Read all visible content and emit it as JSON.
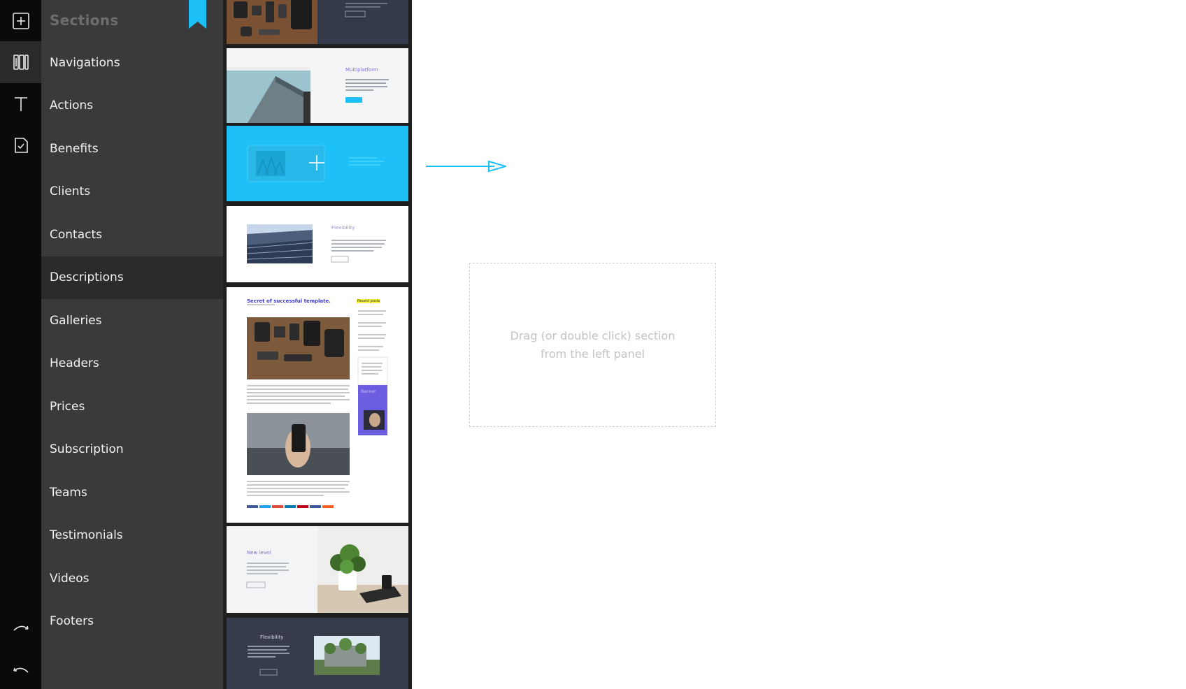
{
  "sidebar": {
    "title": "Sections",
    "items": [
      {
        "label": "Navigations",
        "active": false
      },
      {
        "label": "Actions",
        "active": false
      },
      {
        "label": "Benefits",
        "active": false
      },
      {
        "label": "Clients",
        "active": false
      },
      {
        "label": "Contacts",
        "active": false
      },
      {
        "label": "Descriptions",
        "active": true
      },
      {
        "label": "Galleries",
        "active": false
      },
      {
        "label": "Headers",
        "active": false
      },
      {
        "label": "Prices",
        "active": false
      },
      {
        "label": "Subscription",
        "active": false
      },
      {
        "label": "Teams",
        "active": false
      },
      {
        "label": "Testimonials",
        "active": false
      },
      {
        "label": "Videos",
        "active": false
      },
      {
        "label": "Footers",
        "active": false
      }
    ]
  },
  "rail": {
    "icons": [
      "add-section-icon",
      "sections-icon",
      "text-icon",
      "page-icon",
      "redo-icon",
      "undo-icon"
    ]
  },
  "thumbnails": {
    "multiplatform": {
      "heading": "Multiplatform"
    },
    "flexibility": {
      "heading": "Flexibility"
    },
    "blog": {
      "title": "Secret of successful template.",
      "recent": "Recent posts",
      "banner": "Banner"
    },
    "new_level": {
      "heading": "New level"
    },
    "flexibility_dark": {
      "heading": "Flexibility"
    }
  },
  "canvas": {
    "drop_line1": "Drag (or double click) section",
    "drop_line2": "from the left panel"
  },
  "colors": {
    "accent": "#1ec1f7",
    "rail": "#0a0a0a",
    "sidebar": "#3a3a3a",
    "sidebar_active": "#2b2b2b",
    "dark_thumb": "#373c4d"
  }
}
